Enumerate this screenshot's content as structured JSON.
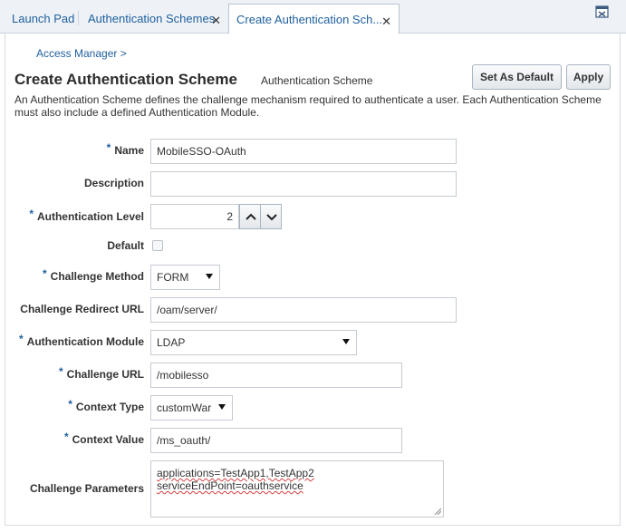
{
  "tabs": [
    {
      "label": "Launch Pad",
      "closable": false
    },
    {
      "label": "Authentication Schemes",
      "closable": true
    },
    {
      "label": "Create Authentication Sch...",
      "closable": true,
      "active": true
    }
  ],
  "icons": {
    "tab_close": "close-icon",
    "detach": "detach-window-icon"
  },
  "breadcrumb": "Access Manager >",
  "header": {
    "title": "Create Authentication Scheme",
    "subtitle": "Authentication Scheme",
    "description": "An Authentication Scheme defines the challenge mechanism required to authenticate a user. Each Authentication Scheme must also include a defined Authentication Module."
  },
  "actions": {
    "set_default": "Set As Default",
    "apply": "Apply"
  },
  "form": {
    "name": {
      "label": "Name",
      "required": true,
      "value": "MobileSSO-OAuth"
    },
    "description": {
      "label": "Description",
      "required": false,
      "value": ""
    },
    "auth_level": {
      "label": "Authentication Level",
      "required": true,
      "value": "2"
    },
    "default": {
      "label": "Default",
      "checked": false
    },
    "challenge_method": {
      "label": "Challenge Method",
      "required": true,
      "value": "FORM"
    },
    "challenge_redirect_url": {
      "label": "Challenge Redirect URL",
      "required": false,
      "value": "/oam/server/"
    },
    "auth_module": {
      "label": "Authentication Module",
      "required": true,
      "value": "LDAP"
    },
    "challenge_url": {
      "label": "Challenge URL",
      "required": true,
      "value": "/mobilesso"
    },
    "context_type": {
      "label": "Context Type",
      "required": true,
      "value": "customWar"
    },
    "context_value": {
      "label": "Context Value",
      "required": true,
      "value": "/ms_oauth/"
    },
    "challenge_parameters": {
      "label": "Challenge Parameters",
      "required": false,
      "line1": "applications=TestApp1,TestApp2",
      "line2": "serviceEndPoint=oauthservice"
    }
  },
  "required_marker": "*",
  "colors": {
    "link": "#1f5f9e",
    "tabbar_bg": "#eef2f6",
    "border": "#c5ccd3"
  }
}
